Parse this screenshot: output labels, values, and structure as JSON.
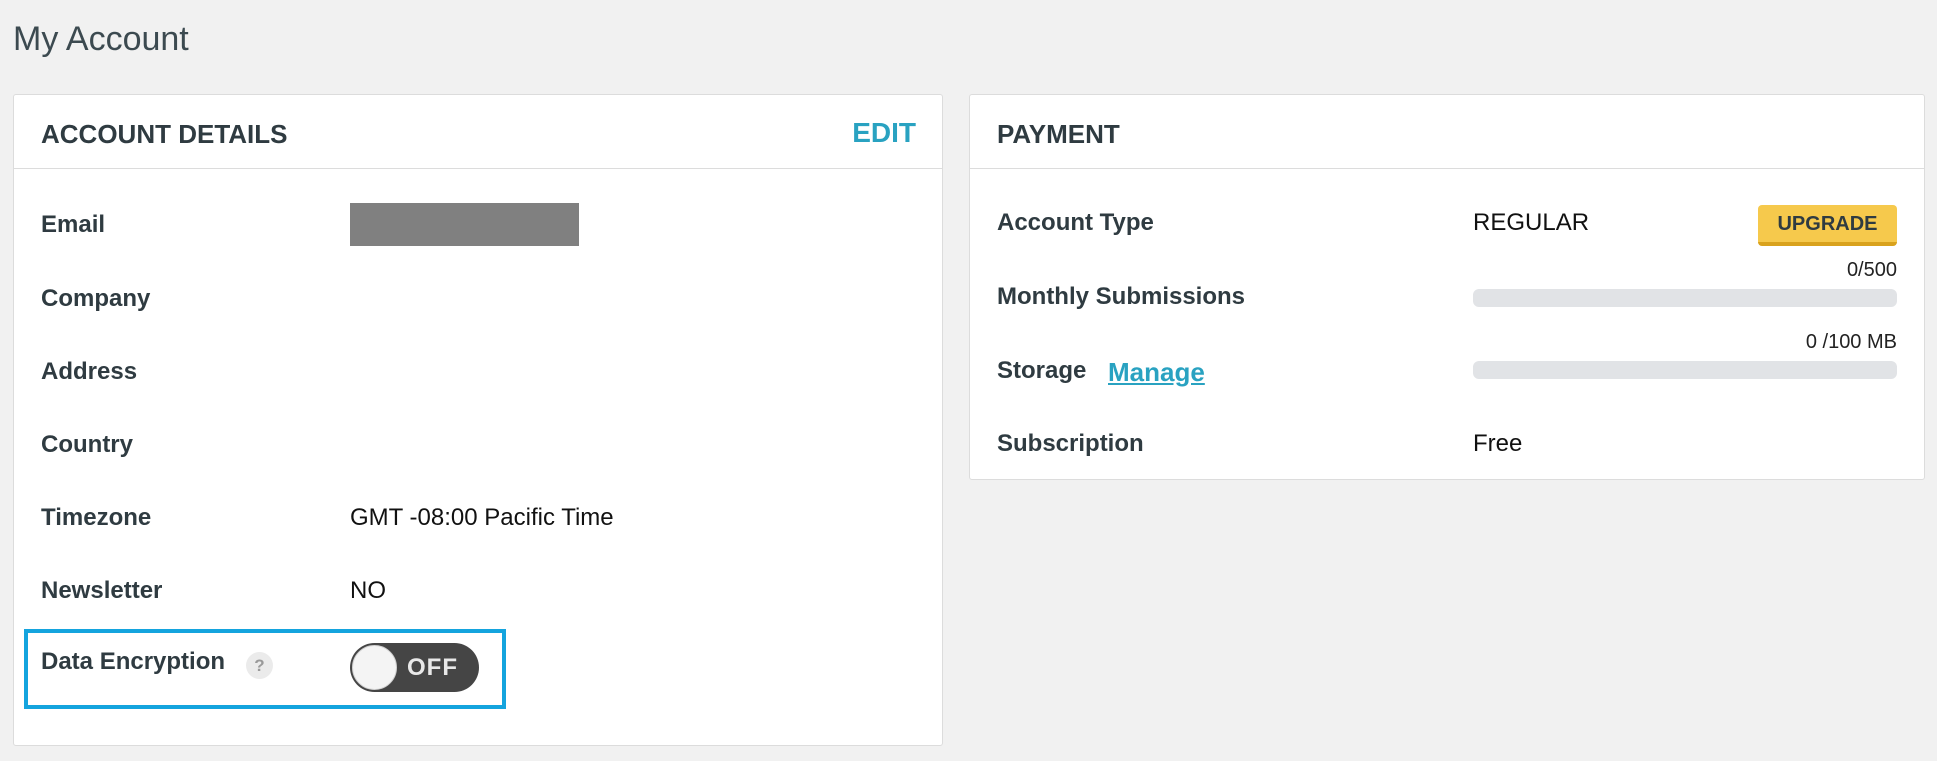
{
  "page": {
    "title": "My Account"
  },
  "account_details": {
    "title": "ACCOUNT DETAILS",
    "edit_label": "EDIT",
    "rows": {
      "email": {
        "label": "Email"
      },
      "company": {
        "label": "Company",
        "value": ""
      },
      "address": {
        "label": "Address",
        "value": ""
      },
      "country": {
        "label": "Country",
        "value": ""
      },
      "timezone": {
        "label": "Timezone",
        "value": "GMT -08:00 Pacific Time"
      },
      "newsletter": {
        "label": "Newsletter",
        "value": "NO"
      },
      "data_encryption": {
        "label": "Data Encryption",
        "help_glyph": "?",
        "toggle_state": "OFF"
      }
    }
  },
  "payment": {
    "title": "PAYMENT",
    "account_type": {
      "label": "Account Type",
      "value": "REGULAR",
      "upgrade_label": "UPGRADE"
    },
    "monthly_submissions": {
      "label": "Monthly Submissions",
      "usage": "0/500",
      "fraction": 0
    },
    "storage": {
      "label": "Storage",
      "manage_label": "Manage",
      "usage": "0 /100 MB",
      "fraction": 0
    },
    "subscription": {
      "label": "Subscription",
      "value": "Free"
    }
  },
  "colors": {
    "accent": "#29a2c1",
    "upgrade": "#f6c94c",
    "highlight_border": "#14a4de",
    "toggle_off": "#454545",
    "background": "#f1f1f1"
  },
  "icons": {
    "help": "help-icon"
  }
}
